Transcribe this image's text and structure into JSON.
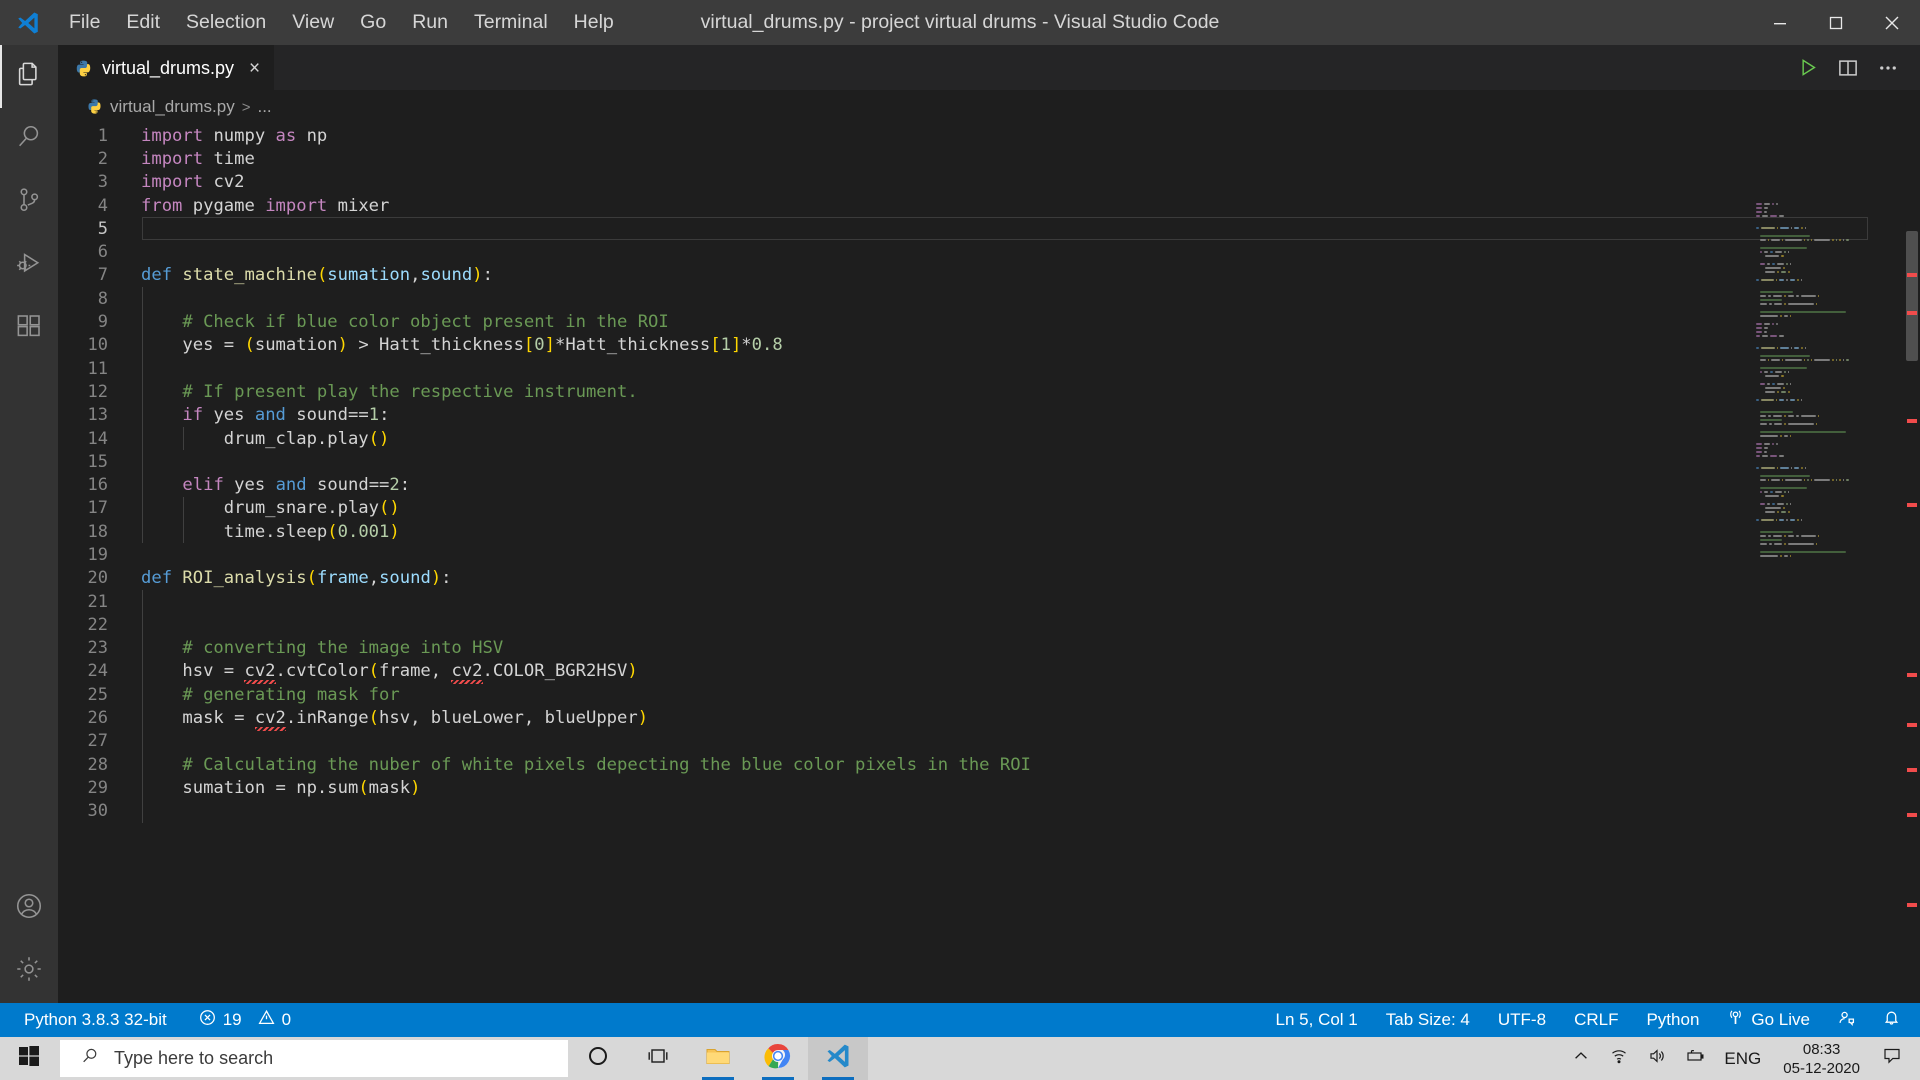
{
  "window": {
    "title": "virtual_drums.py - project virtual drums - Visual Studio Code",
    "menus": [
      "File",
      "Edit",
      "Selection",
      "View",
      "Go",
      "Run",
      "Terminal",
      "Help"
    ],
    "controls": {
      "minimize": "minimize-icon",
      "maximize": "maximize-icon",
      "close": "close-icon"
    }
  },
  "activitybar": {
    "items": [
      {
        "name": "explorer",
        "icon": "files-icon"
      },
      {
        "name": "search",
        "icon": "search-icon"
      },
      {
        "name": "source-control",
        "icon": "source-control-icon"
      },
      {
        "name": "run-debug",
        "icon": "run-debug-icon"
      },
      {
        "name": "extensions",
        "icon": "extensions-icon"
      },
      {
        "name": "accounts",
        "icon": "account-icon"
      },
      {
        "name": "settings",
        "icon": "gear-icon"
      }
    ]
  },
  "tabs": [
    {
      "label": "virtual_drums.py",
      "icon": "python-icon",
      "close": "×",
      "active": true
    }
  ],
  "editor_actions": [
    {
      "name": "run-python-file",
      "icon": "play-icon"
    },
    {
      "name": "split-editor",
      "icon": "split-editor-icon"
    },
    {
      "name": "more-actions",
      "icon": "ellipsis-icon"
    }
  ],
  "breadcrumb": {
    "file": "virtual_drums.py",
    "separator": ">",
    "symbol": "..."
  },
  "code": {
    "first_line": 1,
    "cursor_line": 5,
    "lines": [
      {
        "n": 1,
        "tokens": [
          {
            "t": "import ",
            "c": "k-imp"
          },
          {
            "t": "numpy ",
            "c": "plain"
          },
          {
            "t": "as ",
            "c": "k-imp"
          },
          {
            "t": "np",
            "c": "plain"
          }
        ]
      },
      {
        "n": 2,
        "tokens": [
          {
            "t": "import ",
            "c": "k-imp"
          },
          {
            "t": "time",
            "c": "plain"
          }
        ]
      },
      {
        "n": 3,
        "tokens": [
          {
            "t": "import ",
            "c": "k-imp"
          },
          {
            "t": "cv2",
            "c": "plain"
          }
        ]
      },
      {
        "n": 4,
        "tokens": [
          {
            "t": "from ",
            "c": "k-imp"
          },
          {
            "t": "pygame ",
            "c": "plain"
          },
          {
            "t": "import ",
            "c": "k-imp"
          },
          {
            "t": "mixer",
            "c": "plain"
          }
        ]
      },
      {
        "n": 5,
        "tokens": []
      },
      {
        "n": 6,
        "tokens": []
      },
      {
        "n": 7,
        "tokens": [
          {
            "t": "def ",
            "c": "k-def"
          },
          {
            "t": "state_machine",
            "c": "k-fn"
          },
          {
            "t": "(",
            "c": "paren"
          },
          {
            "t": "sumation",
            "c": "k-var"
          },
          {
            "t": ",",
            "c": "plain"
          },
          {
            "t": "sound",
            "c": "k-var"
          },
          {
            "t": ")",
            "c": "paren"
          },
          {
            "t": ":",
            "c": "plain"
          }
        ]
      },
      {
        "n": 8,
        "tokens": []
      },
      {
        "n": 9,
        "tokens": [
          {
            "t": "    # Check if blue color object present in the ROI",
            "c": "cmt"
          }
        ]
      },
      {
        "n": 10,
        "tokens": [
          {
            "t": "    yes = ",
            "c": "plain"
          },
          {
            "t": "(",
            "c": "paren"
          },
          {
            "t": "sumation",
            "c": "plain"
          },
          {
            "t": ")",
            "c": "paren"
          },
          {
            "t": " > Hatt_thickness",
            "c": "plain"
          },
          {
            "t": "[",
            "c": "brack"
          },
          {
            "t": "0",
            "c": "num"
          },
          {
            "t": "]",
            "c": "brack"
          },
          {
            "t": "*Hatt_thickness",
            "c": "plain"
          },
          {
            "t": "[",
            "c": "brack"
          },
          {
            "t": "1",
            "c": "num"
          },
          {
            "t": "]",
            "c": "brack"
          },
          {
            "t": "*",
            "c": "plain"
          },
          {
            "t": "0.8",
            "c": "num"
          }
        ]
      },
      {
        "n": 11,
        "tokens": []
      },
      {
        "n": 12,
        "tokens": [
          {
            "t": "    # If present play the respective instrument.",
            "c": "cmt"
          }
        ]
      },
      {
        "n": 13,
        "tokens": [
          {
            "t": "    ",
            "c": "plain"
          },
          {
            "t": "if ",
            "c": "k-imp"
          },
          {
            "t": "yes ",
            "c": "plain"
          },
          {
            "t": "and ",
            "c": "k-def"
          },
          {
            "t": "sound==",
            "c": "plain"
          },
          {
            "t": "1",
            "c": "num"
          },
          {
            "t": ":",
            "c": "plain"
          }
        ]
      },
      {
        "n": 14,
        "tokens": [
          {
            "t": "        drum_clap.play",
            "c": "plain"
          },
          {
            "t": "()",
            "c": "paren"
          }
        ]
      },
      {
        "n": 15,
        "tokens": []
      },
      {
        "n": 16,
        "tokens": [
          {
            "t": "    ",
            "c": "plain"
          },
          {
            "t": "elif ",
            "c": "k-imp"
          },
          {
            "t": "yes ",
            "c": "plain"
          },
          {
            "t": "and ",
            "c": "k-def"
          },
          {
            "t": "sound==",
            "c": "plain"
          },
          {
            "t": "2",
            "c": "num"
          },
          {
            "t": ":",
            "c": "plain"
          }
        ]
      },
      {
        "n": 17,
        "tokens": [
          {
            "t": "        drum_snare.play",
            "c": "plain"
          },
          {
            "t": "()",
            "c": "paren"
          }
        ]
      },
      {
        "n": 18,
        "tokens": [
          {
            "t": "        time.sleep",
            "c": "plain"
          },
          {
            "t": "(",
            "c": "paren"
          },
          {
            "t": "0.001",
            "c": "num"
          },
          {
            "t": ")",
            "c": "paren"
          }
        ]
      },
      {
        "n": 19,
        "tokens": []
      },
      {
        "n": 20,
        "tokens": [
          {
            "t": "def ",
            "c": "k-def"
          },
          {
            "t": "ROI_analysis",
            "c": "k-fn"
          },
          {
            "t": "(",
            "c": "paren"
          },
          {
            "t": "frame",
            "c": "k-var"
          },
          {
            "t": ",",
            "c": "plain"
          },
          {
            "t": "sound",
            "c": "k-var"
          },
          {
            "t": ")",
            "c": "paren"
          },
          {
            "t": ":",
            "c": "plain"
          }
        ]
      },
      {
        "n": 21,
        "tokens": []
      },
      {
        "n": 22,
        "tokens": []
      },
      {
        "n": 23,
        "tokens": [
          {
            "t": "    # converting the image into HSV",
            "c": "cmt"
          }
        ]
      },
      {
        "n": 24,
        "tokens": [
          {
            "t": "    hsv = ",
            "c": "plain"
          },
          {
            "t": "cv2",
            "c": "plain squig"
          },
          {
            "t": ".cvtColor",
            "c": "plain"
          },
          {
            "t": "(",
            "c": "paren"
          },
          {
            "t": "frame, ",
            "c": "plain"
          },
          {
            "t": "cv2",
            "c": "plain squig"
          },
          {
            "t": ".COLOR_BGR2HSV",
            "c": "plain"
          },
          {
            "t": ")",
            "c": "paren"
          }
        ]
      },
      {
        "n": 25,
        "tokens": [
          {
            "t": "    # generating mask for",
            "c": "cmt"
          }
        ]
      },
      {
        "n": 26,
        "tokens": [
          {
            "t": "    mask = ",
            "c": "plain"
          },
          {
            "t": "cv2",
            "c": "plain squig"
          },
          {
            "t": ".inRange",
            "c": "plain"
          },
          {
            "t": "(",
            "c": "paren"
          },
          {
            "t": "hsv, blueLower, blueUpper",
            "c": "plain"
          },
          {
            "t": ")",
            "c": "paren"
          }
        ]
      },
      {
        "n": 27,
        "tokens": []
      },
      {
        "n": 28,
        "tokens": [
          {
            "t": "    # Calculating the nuber of white pixels depecting the blue color pixels in the ROI",
            "c": "cmt"
          }
        ]
      },
      {
        "n": 29,
        "tokens": [
          {
            "t": "    sumation = np.sum",
            "c": "plain"
          },
          {
            "t": "(",
            "c": "paren"
          },
          {
            "t": "mask",
            "c": "plain"
          },
          {
            "t": ")",
            "c": "paren"
          }
        ]
      },
      {
        "n": 30,
        "tokens": []
      }
    ]
  },
  "statusbar": {
    "python_version": "Python 3.8.3 32-bit",
    "errors": "19",
    "warnings": "0",
    "error_icon": "error-circle-icon",
    "warning_icon": "warning-triangle-icon",
    "cursor_position": "Ln 5, Col 1",
    "tab_size": "Tab Size: 4",
    "encoding": "UTF-8",
    "eol": "CRLF",
    "language": "Python",
    "go_live": "Go Live",
    "go_live_icon": "broadcast-icon",
    "feedback_icon": "feedback-smiley-icon",
    "bell_icon": "bell-icon",
    "accent": "#007acc"
  },
  "taskbar": {
    "start_icon": "windows-start-icon",
    "search_placeholder": "Type here to search",
    "search_icon": "search-icon",
    "cortana_icon": "cortana-circle-icon",
    "taskview_icon": "task-view-icon",
    "pinned": [
      {
        "name": "file-explorer",
        "icon": "folder-icon"
      },
      {
        "name": "google-chrome",
        "icon": "chrome-icon"
      },
      {
        "name": "visual-studio-code",
        "icon": "vscode-icon"
      }
    ],
    "tray": {
      "chevron_icon": "chevron-up-icon",
      "wifi_icon": "wifi-icon",
      "volume_icon": "speaker-icon",
      "battery_icon": "battery-charging-icon",
      "language": "ENG",
      "time": "08:33",
      "date": "05-12-2020",
      "notification_icon": "notification-icon"
    }
  }
}
